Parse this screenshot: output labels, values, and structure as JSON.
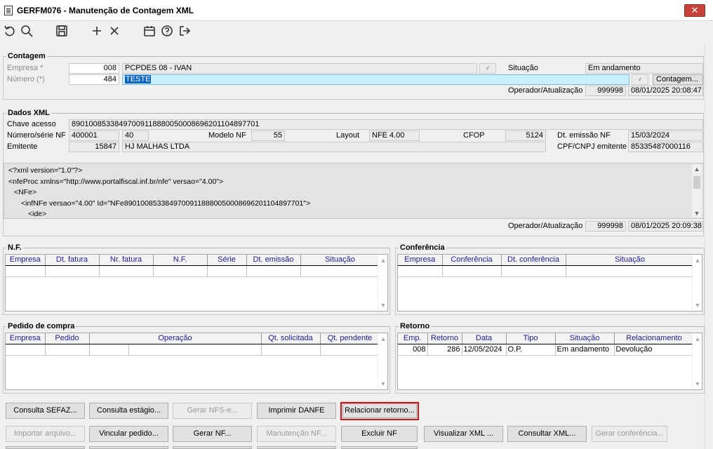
{
  "window": {
    "title": "GERFM076 - Manutenção de Contagem XML",
    "close_label": "✕"
  },
  "toolbar": {
    "icons": [
      "undo-icon",
      "search-icon",
      "save-icon",
      "add-icon",
      "delete-icon",
      "calendar-icon",
      "help-icon",
      "exit-icon"
    ]
  },
  "contagem": {
    "title": "Contagem",
    "empresa_label": "Empresa *",
    "empresa_code": "008",
    "empresa_name": "PCPDES 08 - IVAN",
    "numero_label": "Número (*)",
    "numero_value": "484",
    "descricao_selected": "TESTE",
    "situacao_label": "Situação",
    "situacao_value": "Em andamento",
    "contagem_button": "Contagem...",
    "operador_label": "Operador/Atualização",
    "operador_value": "999998",
    "atualizacao_value": "08/01/2025 20:08:47"
  },
  "dados_xml": {
    "title": "Dados XML",
    "chave_label": "Chave acesso",
    "chave_value": "89010085338497009118880050008696201104897701",
    "numero_serie_label": "Número/série NF",
    "numero_nf": "400001",
    "serie_nf": "40",
    "modelo_label": "Modelo NF",
    "modelo_value": "55",
    "layout_label": "Layout",
    "layout_value": "NFE 4.00",
    "cfop_label": "CFOP",
    "cfop_value": "5124",
    "dt_emissao_label": "Dt. emissão NF",
    "dt_emissao_value": "15/03/2024",
    "emitente_label": "Emitente",
    "emitente_code": "15847",
    "emitente_name": "HJ MALHAS LTDA",
    "cpf_cnpj_label": "CPF/CNPJ emitente",
    "cpf_cnpj_value": "85335487000116",
    "xml_lines": [
      "<?xml version=\"1.0\"?>",
      "<nfeProc xmlns=\"http://www.portalfiscal.inf.br/nfe\" versao=\"4.00\">",
      "<NFe>",
      "<infNFe versao=\"4.00\" Id=\"NFe89010085338497009118880050008696201104897701\">",
      "<ide>"
    ],
    "operador_label": "Operador/Atualização",
    "operador_value": "999998",
    "atualizacao_value": "08/01/2025 20:09:38"
  },
  "nf": {
    "title": "N.F.",
    "columns": [
      "Empresa",
      "Dt. fatura",
      "Nr. fatura",
      "N.F.",
      "Série",
      "Dt. emissão",
      "Situação"
    ]
  },
  "conferencia": {
    "title": "Conferência",
    "columns": [
      "Empresa",
      "Conferência",
      "Dt. conferência",
      "Situação"
    ]
  },
  "pedido": {
    "title": "Pedido de compra",
    "columns": [
      "Empresa",
      "Pedido",
      "Operação",
      "Qt. solicitada",
      "Qt. pendente"
    ]
  },
  "retorno": {
    "title": "Retorno",
    "columns": [
      "Emp.",
      "Retorno",
      "Data",
      "Tipo",
      "Situação",
      "Relacionamento"
    ],
    "rows": [
      {
        "emp": "008",
        "retorno": "286",
        "data": "12/05/2024",
        "tipo": "O.P.",
        "situacao": "Em andamento",
        "relacionamento": "Devolução"
      }
    ]
  },
  "buttons": {
    "consultar_sefaz": "Consulta SEFAZ...",
    "consultar_estagio": "Consulta estágio...",
    "gerar_nfs": "Gerar NFS-e...",
    "imprimir_danfe": "Imprimir DANFE",
    "relacionar_retorno": "Relacionar retorno...",
    "importar_arquivo": "Importar arquivo...",
    "vincular_pedido": "Vincular pedido...",
    "gerar_nf": "Gerar NF...",
    "manutencao_nf": "Manutenção NF...",
    "excluir_nf": "Excluir NF",
    "visualizar_xml": "Visualizar XML ...",
    "consultar_xml": "Consultar XML...",
    "gerar_conferencia": "Gerar conferência..."
  },
  "colors": {
    "accent": "#0a64c8",
    "highlight_border": "#e01010",
    "close_button": "#c7423a",
    "selected_field": "#c9f0ff"
  }
}
